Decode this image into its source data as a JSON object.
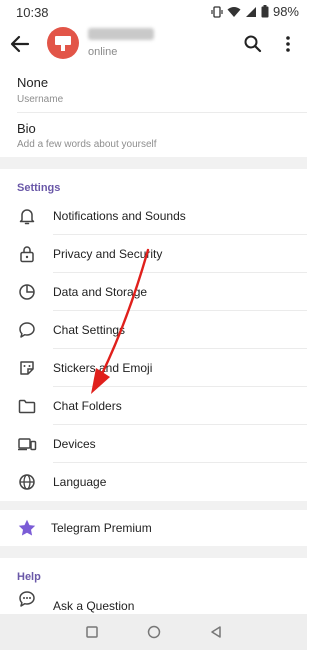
{
  "status_bar": {
    "time": "10:38",
    "battery": "98%"
  },
  "header": {
    "status": "online"
  },
  "profile": {
    "username_value": "None",
    "username_hint": "Username",
    "bio_value": "Bio",
    "bio_hint": "Add a few words about yourself"
  },
  "settings": {
    "title": "Settings",
    "items": [
      {
        "label": "Notifications and Sounds",
        "icon": "bell-icon"
      },
      {
        "label": "Privacy and Security",
        "icon": "lock-icon"
      },
      {
        "label": "Data and Storage",
        "icon": "pie-chart-icon"
      },
      {
        "label": "Chat Settings",
        "icon": "chat-bubble-icon"
      },
      {
        "label": "Stickers and Emoji",
        "icon": "sticker-icon"
      },
      {
        "label": "Chat Folders",
        "icon": "folder-icon"
      },
      {
        "label": "Devices",
        "icon": "devices-icon"
      },
      {
        "label": "Language",
        "icon": "globe-icon"
      }
    ]
  },
  "premium": {
    "label": "Telegram Premium",
    "icon": "star-icon",
    "accent": "#7b5cd6"
  },
  "help": {
    "title": "Help",
    "items": [
      {
        "label": "Ask a Question",
        "icon": "chat-dots-icon"
      }
    ]
  },
  "colors": {
    "section_title": "#6a58a8",
    "annotation_arrow": "#e0201c",
    "avatar": "#e25548"
  }
}
